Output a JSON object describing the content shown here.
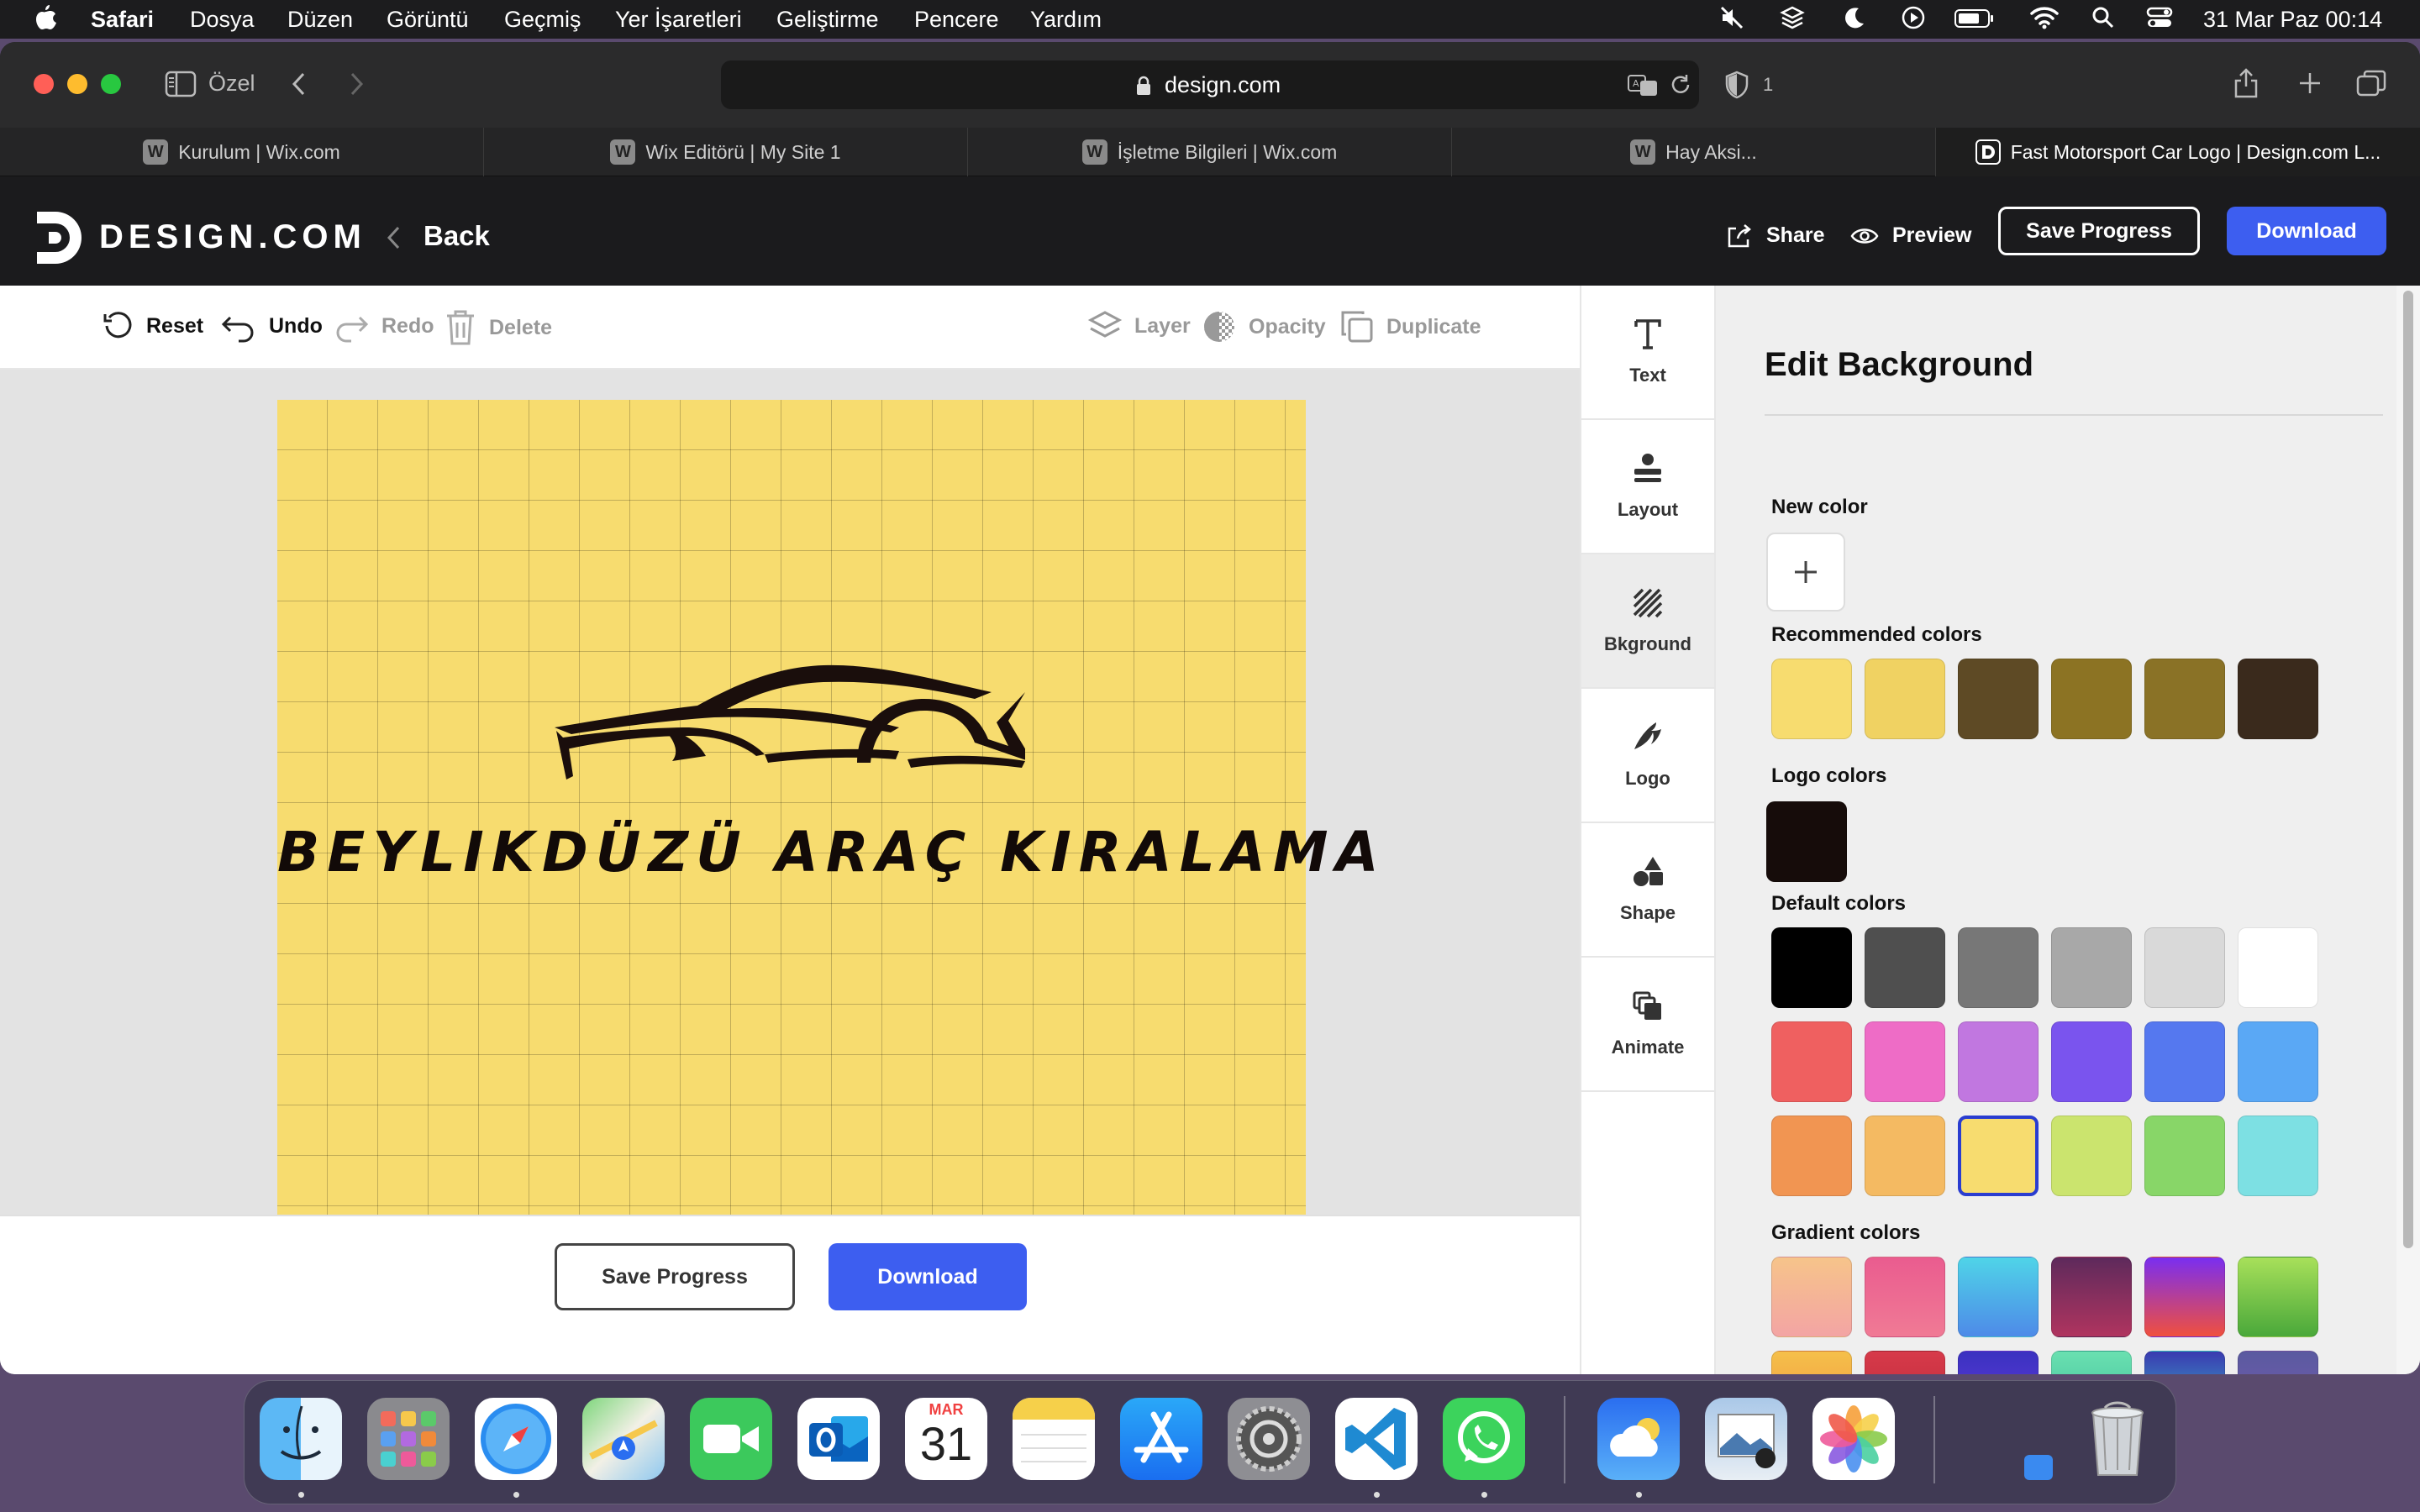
{
  "menubar": {
    "app_name": "Safari",
    "menus": [
      "Dosya",
      "Düzen",
      "Görüntü",
      "Geçmiş",
      "Yer İşaretleri",
      "Geliştirme",
      "Pencere",
      "Yardım"
    ],
    "datetime": "31 Mar Paz  00:14"
  },
  "browser": {
    "sidebar_label": "Özel",
    "url": "design.com",
    "shield_count": "1",
    "tabs": [
      {
        "label": "Kurulum | Wix.com"
      },
      {
        "label": "Wix Editörü | My Site 1"
      },
      {
        "label": "İşletme Bilgileri | Wix.com"
      },
      {
        "label": "Hay Aksi..."
      },
      {
        "label": "Fast Motorsport Car Logo | Design.com L..."
      }
    ]
  },
  "site": {
    "brand": "DESIGN.COM",
    "back_label": "Back",
    "share_label": "Share",
    "preview_label": "Preview",
    "save_progress_label": "Save Progress",
    "download_label": "Download"
  },
  "edit_toolbar": {
    "reset": "Reset",
    "undo": "Undo",
    "redo": "Redo",
    "delete": "Delete",
    "layer": "Layer",
    "opacity": "Opacity",
    "duplicate": "Duplicate"
  },
  "canvas": {
    "logo_text": "BEYLIKDÜZÜ ARAÇ KIRALAMA",
    "background_color": "#f7dc6f"
  },
  "bottom_bar": {
    "save_progress_label": "Save Progress",
    "download_label": "Download"
  },
  "side_nav": [
    {
      "label": "Text",
      "icon": "text-icon"
    },
    {
      "label": "Layout",
      "icon": "layout-icon"
    },
    {
      "label": "Bkground",
      "icon": "background-icon",
      "active": true
    },
    {
      "label": "Logo",
      "icon": "logo-icon"
    },
    {
      "label": "Shape",
      "icon": "shape-icon"
    },
    {
      "label": "Animate",
      "icon": "animate-icon"
    }
  ],
  "panel": {
    "title": "Edit Background",
    "new_color_label": "New color",
    "recommended_label": "Recommended colors",
    "recommended_colors": [
      "#f7dc6f",
      "#f0d262",
      "#5e4a25",
      "#8c7323",
      "#8a7226",
      "#3a2a1c"
    ],
    "logo_colors_label": "Logo colors",
    "logo_colors": [
      "#160c0a"
    ],
    "default_label": "Default colors",
    "default_colors": [
      "#000000",
      "#4f4f4f",
      "#777777",
      "#a8a8a8",
      "#d9d9d9",
      "#ffffff",
      "#ef6060",
      "#ee6cc6",
      "#c177e0",
      "#7a54ee",
      "#5578ef",
      "#5aa8f5",
      "#f19552",
      "#f4ba62",
      "#f7dc6f",
      "#cbe46e",
      "#88d668",
      "#7de0e3"
    ],
    "selected_default_index": 14,
    "gradient_label": "Gradient colors",
    "gradient_colors": [
      [
        "#f6c48a",
        "#f3a4a4"
      ],
      [
        "#ea5c8f",
        "#f07a95"
      ],
      [
        "#4fd4e8",
        "#4e8ae8"
      ],
      [
        "#5e2a5c",
        "#b0345f"
      ],
      [
        "#7a2ef0",
        "#f0503e"
      ],
      [
        "#a8e05a",
        "#4aa83a"
      ],
      [
        "#f5c04a",
        "#f09042"
      ],
      [
        "#d73a4a",
        "#b82838"
      ],
      [
        "#3a32c0",
        "#6a3ae0"
      ],
      [
        "#6ae0b0",
        "#3aba9a"
      ],
      [
        "#3a3ab0",
        "#3ad0d0"
      ],
      [
        "#5a5aa0",
        "#7a5ab0"
      ]
    ]
  },
  "dock": {
    "apps": [
      "Finder",
      "Launchpad",
      "Safari",
      "Maps",
      "FaceTime",
      "Outlook",
      "Calendar",
      "Notes",
      "App Store",
      "System Settings",
      "Visual Studio Code",
      "WhatsApp",
      "Weather",
      "Preview",
      "Photos",
      "Trash"
    ],
    "calendar_month": "MAR",
    "calendar_day": "31"
  }
}
